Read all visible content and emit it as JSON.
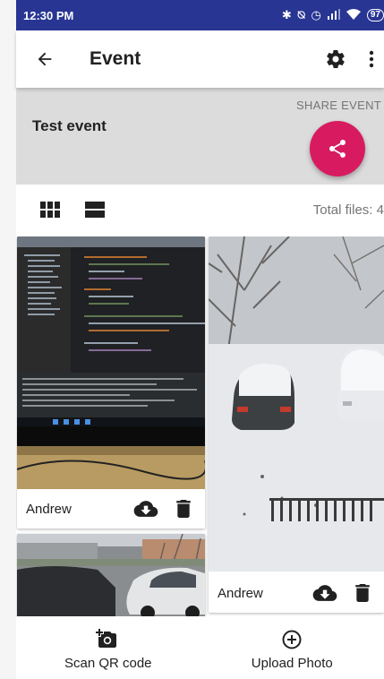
{
  "status_bar": {
    "time": "12:30 PM",
    "battery": "97",
    "icons": [
      "bluetooth-icon",
      "mute-icon",
      "alarm-icon",
      "signal-icon",
      "wifi-icon",
      "battery-icon"
    ]
  },
  "app_bar": {
    "title": "Event",
    "back_icon": "arrow-back-icon",
    "settings_icon": "gear-icon",
    "more_icon": "more-vert-icon"
  },
  "event": {
    "name": "Test event",
    "share_label": "SHARE EVENT",
    "share_icon": "share-icon",
    "fab_color": "#d81b60"
  },
  "view_controls": {
    "grid_icon": "grid-view-icon",
    "list_icon": "list-view-icon",
    "total_files": "Total files: 4"
  },
  "photos": [
    {
      "author": "Andrew",
      "content": "monitor-with-code-editor",
      "download_icon": "cloud-download-icon",
      "delete_icon": "trash-icon"
    },
    {
      "author": "Andrew",
      "content": "snowy-parking-lot",
      "download_icon": "cloud-download-icon",
      "delete_icon": "trash-icon"
    },
    {
      "content": "street-with-parked-cars"
    }
  ],
  "bottom_bar": {
    "scan_label": "Scan QR code",
    "scan_icon": "add-camera-icon",
    "upload_label": "Upload Photo",
    "upload_icon": "add-circle-icon"
  },
  "colors": {
    "status_bar": "#283593",
    "header_bg": "#dcdcdc",
    "accent": "#d81b60",
    "secondary_text": "#757575"
  }
}
